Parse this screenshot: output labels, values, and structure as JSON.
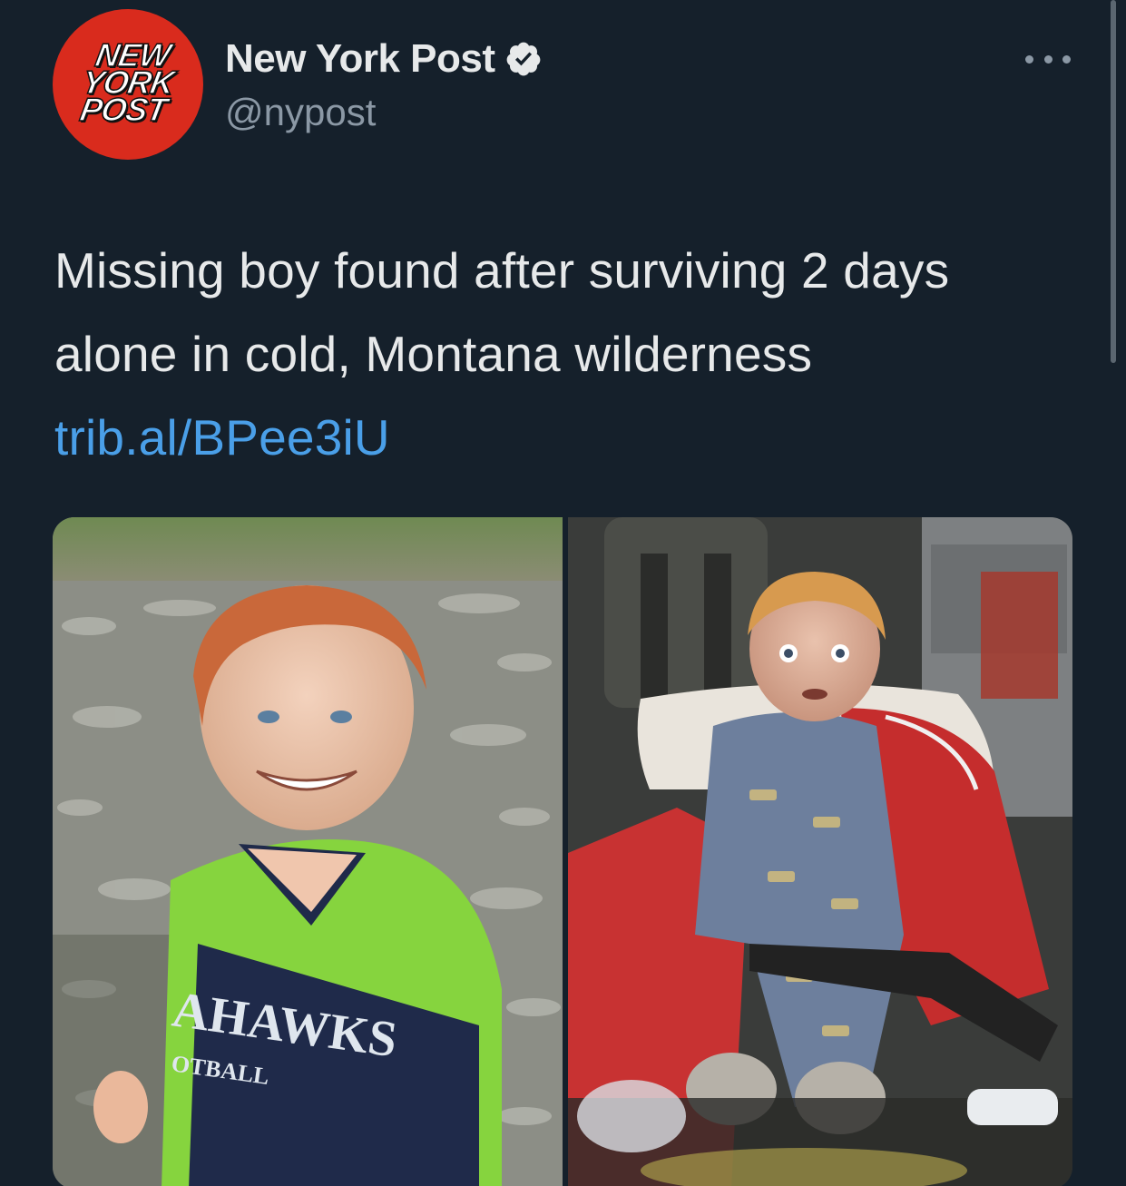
{
  "account": {
    "avatar_logo_lines": [
      "NEW",
      "YORK",
      "POST"
    ],
    "display_name": "New York Post",
    "handle": "@nypost",
    "verified": true,
    "avatar_color": "#d92b1d"
  },
  "tweet": {
    "text": "Missing boy found after surviving 2 days alone in cold, Montana wilderness ",
    "link_text": "trib.al/BPee3iU",
    "link_color": "#4a9fe8"
  },
  "media": {
    "left_photo": {
      "jersey_text": "AHAWKS",
      "jersey_sub": "OTBALL",
      "icon": "photo-boy-jersey"
    },
    "right_photo": {
      "icon": "photo-boy-ambulance"
    }
  },
  "icons": {
    "verified": "verified-badge-icon",
    "more": "more-options-icon"
  },
  "theme": {
    "background": "#15202b",
    "text": "#e7e9ea",
    "secondary": "#8b98a5"
  }
}
